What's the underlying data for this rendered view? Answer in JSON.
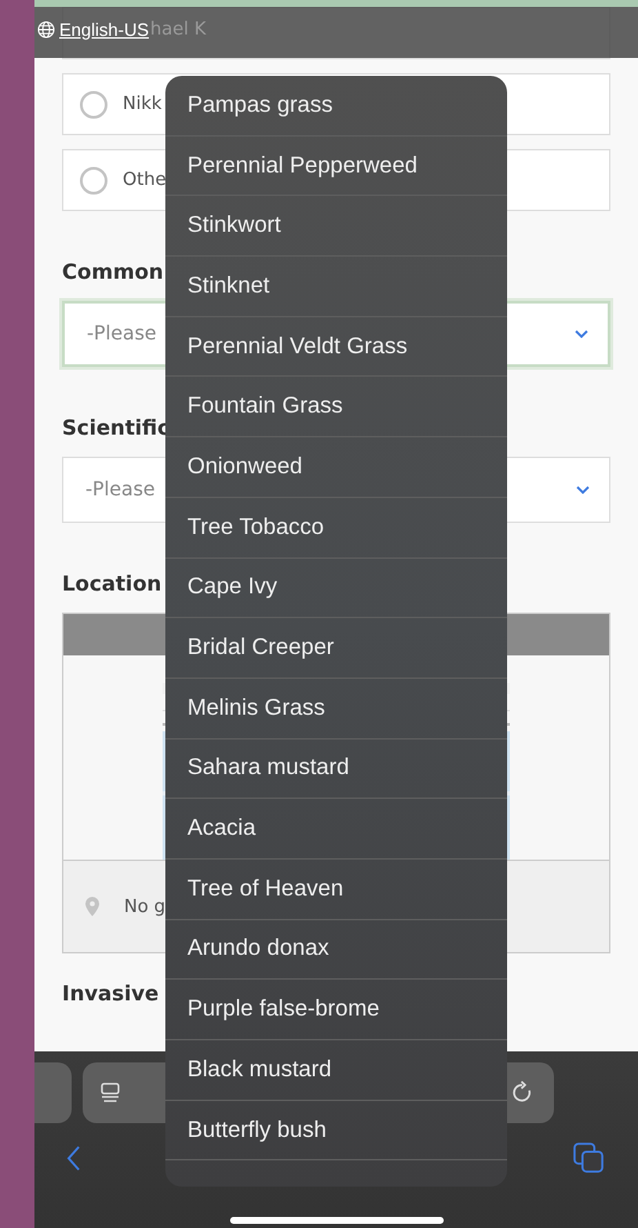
{
  "language_link": "English-US",
  "radio_options": [
    {
      "label": "hael K",
      "kind": "covered"
    },
    {
      "label": "Nikk",
      "selected": false
    },
    {
      "label": "Othe",
      "selected": false
    }
  ],
  "common_name": {
    "label": "Common",
    "placeholder": "-Please",
    "focused": true
  },
  "scientific_name": {
    "label": "Scientific",
    "placeholder": "-Please",
    "focused": false
  },
  "location": {
    "label": "Location",
    "status": "No g"
  },
  "invasive_heading": "Invasive",
  "dropdown_menu": {
    "items": [
      {
        "label": "Pampas grass"
      },
      {
        "label": "Perennial Pepperweed"
      },
      {
        "label": "Stinkwort"
      },
      {
        "label": "Stinknet"
      },
      {
        "label": "Perennial Veldt Grass"
      },
      {
        "label": "Fountain Grass"
      },
      {
        "label": "Onionweed"
      },
      {
        "label": "Tree Tobacco"
      },
      {
        "label": "Cape Ivy"
      },
      {
        "label": "Bridal Creeper"
      },
      {
        "label": "Melinis Grass"
      },
      {
        "label": "Sahara mustard"
      },
      {
        "label": "Acacia"
      },
      {
        "label": "Tree of Heaven"
      },
      {
        "label": "Arundo donax"
      },
      {
        "label": "Purple false-brome"
      },
      {
        "label": "Black mustard"
      },
      {
        "label": "Butterfly bush"
      }
    ]
  }
}
